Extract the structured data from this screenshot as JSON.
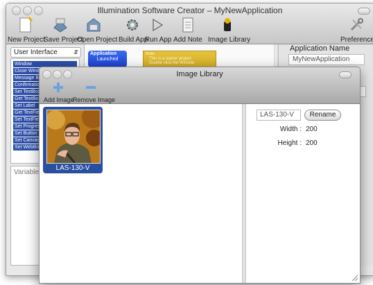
{
  "main_window": {
    "title": "Illumination Software Creator – MyNewApplication",
    "toolbar": [
      {
        "label": "New Project",
        "icon": "new-project-icon"
      },
      {
        "label": "Save Project",
        "icon": "save-project-icon"
      },
      {
        "label": "Open Project",
        "icon": "open-project-icon"
      },
      {
        "label": "Build App",
        "icon": "build-app-icon"
      },
      {
        "label": "Run App",
        "icon": "run-app-icon"
      },
      {
        "label": "Add Note",
        "icon": "add-note-icon"
      },
      {
        "label": "Image Library",
        "icon": "image-library-icon"
      },
      {
        "label": "Preferences",
        "icon": "preferences-icon"
      }
    ]
  },
  "left_pane": {
    "category_select": "User Interface",
    "items": [
      "Window",
      "Close Window",
      "Message Bo",
      "Confirmatio",
      "Set TextBox",
      "Get TextBo",
      "Set Label",
      "Get TextFiel",
      "Set TextFie",
      "Set Progres",
      "Set Button",
      "Set Canvas",
      "Set WebBro"
    ],
    "variables_label": "Variables"
  },
  "canvas": {
    "app_node": {
      "title": "Application",
      "subtitle": "Launched"
    },
    "note": {
      "title": "Note",
      "line1": "This is a starter project.",
      "line2": "Double click the Window"
    }
  },
  "right_pane": {
    "app_name_label": "Application Name",
    "app_name_value": "MyNewApplication"
  },
  "image_library": {
    "title": "Image Library",
    "toolbar": [
      {
        "label": "Add Image",
        "icon": "add-image-icon"
      },
      {
        "label": "Remove Image",
        "icon": "remove-image-icon"
      }
    ],
    "images": [
      {
        "name": "LAS-130-V"
      }
    ],
    "detail": {
      "name_value": "LAS-130-V",
      "rename_label": "Rename",
      "width_label": "Width :",
      "width_value": "200",
      "height_label": "Height :",
      "height_value": "200"
    }
  },
  "colors": {
    "selection_blue": "#2a4fa0",
    "node_blue": "#1c3fd0",
    "note_gold": "#cfa720"
  }
}
